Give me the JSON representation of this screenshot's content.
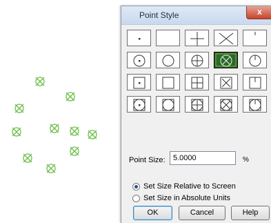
{
  "dialog": {
    "title": "Point Style",
    "close_glyph": "x",
    "point_styles": [
      [
        "dot",
        "none",
        "plus",
        "cross",
        "tick"
      ],
      [
        "circle-dot",
        "circle",
        "circle-plus",
        "circle-cross",
        "circle-tick"
      ],
      [
        "square-dot",
        "square",
        "square-plus",
        "square-cross",
        "square-tick"
      ],
      [
        "sqcirc-dot",
        "sqcirc",
        "sqcirc-plus",
        "sqcirc-cross",
        "sqcirc-tick"
      ]
    ],
    "selected_style": "circle-cross",
    "point_size_label": "Point Size:",
    "point_size_value": "5.0000",
    "point_size_unit": "%",
    "radio_relative": "Set Size Relative to Screen",
    "radio_absolute": "Set Size in Absolute Units",
    "radio_selected": "relative",
    "ok_label": "OK",
    "cancel_label": "Cancel",
    "help_label": "Help"
  },
  "canvas": {
    "marker_color": "#6cc04a",
    "marker_style": "circle-cross",
    "marker_count": 11
  }
}
